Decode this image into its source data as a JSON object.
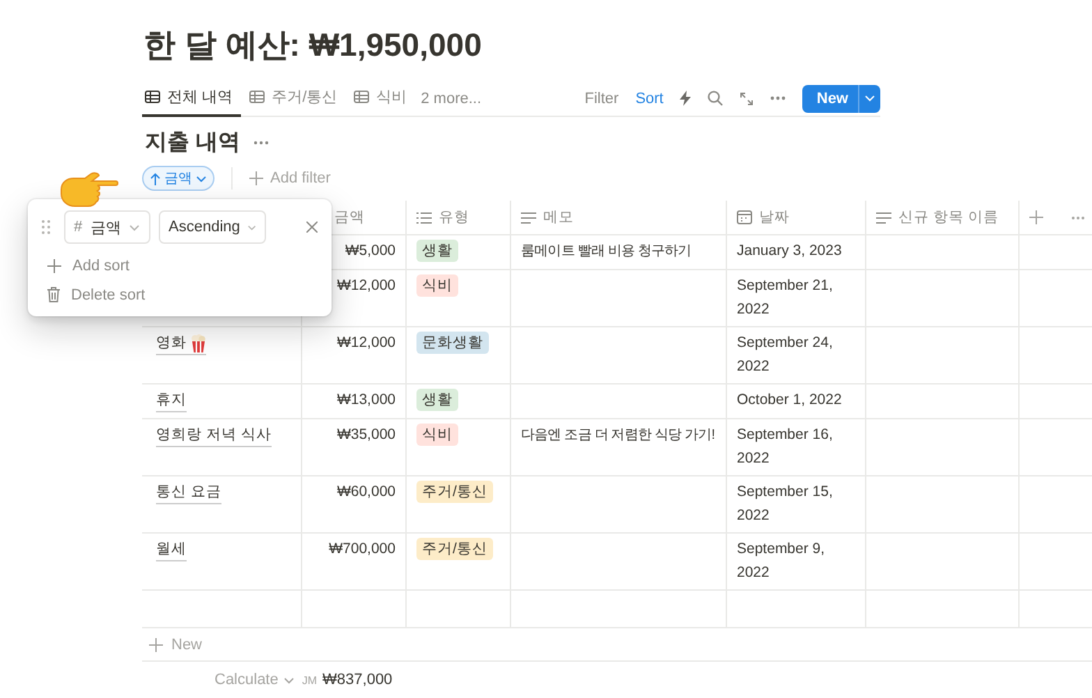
{
  "title": "한 달 예산: ₩1,950,000",
  "views": [
    {
      "label": "전체 내역",
      "selected": true
    },
    {
      "label": "주거/통신",
      "selected": false
    },
    {
      "label": "식비",
      "selected": false
    }
  ],
  "more_views": "2 more...",
  "toolbar": {
    "filter": "Filter",
    "sort": "Sort",
    "new_button": "New"
  },
  "section_title": "지출 내역",
  "sort_chip": {
    "label": "금액"
  },
  "add_filter": "Add filter",
  "columns": [
    {},
    {
      "label": "금액"
    },
    {
      "label": "유형"
    },
    {
      "label": "메모"
    },
    {
      "label": "날짜"
    },
    {
      "label": "신규 항목 이름"
    }
  ],
  "rows": [
    {
      "amount": "₩5,000",
      "tag": {
        "label": "생활",
        "color": "#dbeddb"
      },
      "memo": "룸메이트 빨래 비용 청구하기",
      "date": "January 3, 2023"
    },
    {
      "amount": "₩12,000",
      "tag": {
        "label": "식비",
        "color": "#ffe2dd"
      },
      "date": "September 21, 2022"
    },
    {
      "name": "영화",
      "popcorn": true,
      "amount": "₩12,000",
      "tag": {
        "label": "문화생활",
        "color": "#d3e5ef"
      },
      "date": "September 24, 2022"
    },
    {
      "name": "휴지",
      "amount": "₩13,000",
      "tag": {
        "label": "생활",
        "color": "#dbeddb"
      },
      "date": "October 1, 2022"
    },
    {
      "name": "영희랑 저녁 식사",
      "amount": "₩35,000",
      "tag": {
        "label": "식비",
        "color": "#ffe2dd"
      },
      "memo": "다음엔 조금 더 저렴한 식당 가기!",
      "date": "September 16, 2022"
    },
    {
      "name": "통신 요금",
      "amount": "₩60,000",
      "tag": {
        "label": "주거/통신",
        "color": "#fdecc8"
      },
      "date": "September 15, 2022"
    },
    {
      "name": "월세",
      "amount": "₩700,000",
      "tag": {
        "label": "주거/통신",
        "color": "#fdecc8"
      },
      "date": "September 9, 2022"
    }
  ],
  "new_row": "New",
  "footer": {
    "calculate": "Calculate",
    "label": "JM",
    "total": "₩837,000"
  },
  "sort_popup": {
    "property_symbol": "#",
    "property": "금액",
    "direction": "Ascending",
    "add_sort": "Add sort",
    "delete_sort": "Delete sort"
  }
}
